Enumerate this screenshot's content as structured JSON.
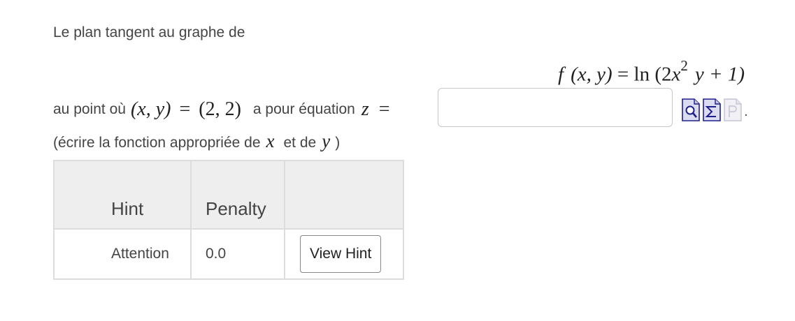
{
  "question": {
    "intro": "Le plan tangent au graphe de",
    "formula": {
      "f": "f",
      "args": "(x, y)",
      "eq": "=",
      "ln": "ln",
      "open": "(2",
      "x": "x",
      "exp": "2",
      "rest": "y + 1)"
    },
    "line2": {
      "prefix": "au point où",
      "point_lhs": "(x, y)",
      "eq": "=",
      "point_rhs": "(2, 2)",
      "middle": "a pour équation",
      "z": "z",
      "eq2": "="
    },
    "line3": {
      "open": "(écrire la fonction appropriée de",
      "x": "x",
      "and": "et de",
      "y": "y",
      "close": ")"
    }
  },
  "answer": {
    "value": "",
    "placeholder": ""
  },
  "tools": {
    "icons": [
      "preview-icon",
      "equation-editor-icon",
      "pdf-icon"
    ],
    "period": "."
  },
  "hints_table": {
    "headers": [
      "Hint",
      "Penalty",
      ""
    ],
    "rows": [
      {
        "hint": "Attention",
        "penalty": "0.0",
        "action": "View Hint"
      }
    ]
  },
  "colors": {
    "text": "#444444",
    "math": "#222222",
    "border": "#dddddd",
    "header_bg": "#eeeeee",
    "icon_blue": "#1e1e8c"
  }
}
